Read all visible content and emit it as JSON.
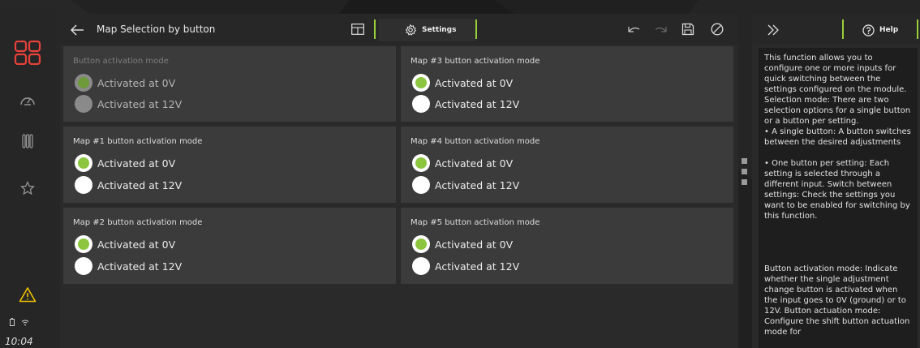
{
  "status": {
    "time": "10:04"
  },
  "header": {
    "title": "Map Selection by button",
    "settings_label": "Settings"
  },
  "cards": [
    {
      "title": "Button activation mode",
      "disabled": true,
      "options": [
        {
          "label": "Activated at 0V",
          "selected": true
        },
        {
          "label": "Activated at 12V",
          "selected": false
        }
      ]
    },
    {
      "title": "Map #3 button activation mode",
      "disabled": false,
      "options": [
        {
          "label": "Activated at 0V",
          "selected": true
        },
        {
          "label": "Activated at 12V",
          "selected": false
        }
      ]
    },
    {
      "title": "Map #1 button activation mode",
      "disabled": false,
      "options": [
        {
          "label": "Activated at 0V",
          "selected": true
        },
        {
          "label": "Activated at 12V",
          "selected": false
        }
      ]
    },
    {
      "title": "Map #4 button activation mode",
      "disabled": false,
      "options": [
        {
          "label": "Activated at 0V",
          "selected": true
        },
        {
          "label": "Activated at 12V",
          "selected": false
        }
      ]
    },
    {
      "title": "Map #2 button activation mode",
      "disabled": false,
      "options": [
        {
          "label": "Activated at 0V",
          "selected": true
        },
        {
          "label": "Activated at 12V",
          "selected": false
        }
      ]
    },
    {
      "title": "Map #5 button activation mode",
      "disabled": false,
      "options": [
        {
          "label": "Activated at 0V",
          "selected": true
        },
        {
          "label": "Activated at 12V",
          "selected": false
        }
      ]
    }
  ],
  "help": {
    "tab_label": "Help",
    "paragraphs": [
      "This function allows you to configure one or more inputs for quick switching between the settings configured on the module. Selection mode: There are two selection options for a single button or a button per setting.",
      "• A single button: A button switches between the desired adjustments",
      "• One button per setting: Each setting is selected through a different input. Switch between settings: Check the settings you want to be enabled for switching by this function.",
      "Button activation mode: Indicate whether the single adjustment change button is activated when the input goes to 0V (ground) or to 12V. Button actuation mode: Configure the shift button actuation mode for"
    ]
  },
  "colors": {
    "accent": "#8cc63f",
    "brand_red": "#e8423a",
    "warning": "#f2c200"
  },
  "icons": {
    "rail": [
      "home-grid-icon",
      "dashboard-gauge-icon",
      "bars-icon",
      "star-icon",
      "warning-icon",
      "battery-icon",
      "wifi-icon"
    ],
    "toolbar": [
      "back-arrow-icon",
      "table-grid-icon",
      "gear-icon",
      "undo-icon",
      "redo-icon",
      "save-icon",
      "cancel-icon"
    ],
    "help": [
      "collapse-chevrons-icon",
      "help-circle-icon"
    ]
  }
}
